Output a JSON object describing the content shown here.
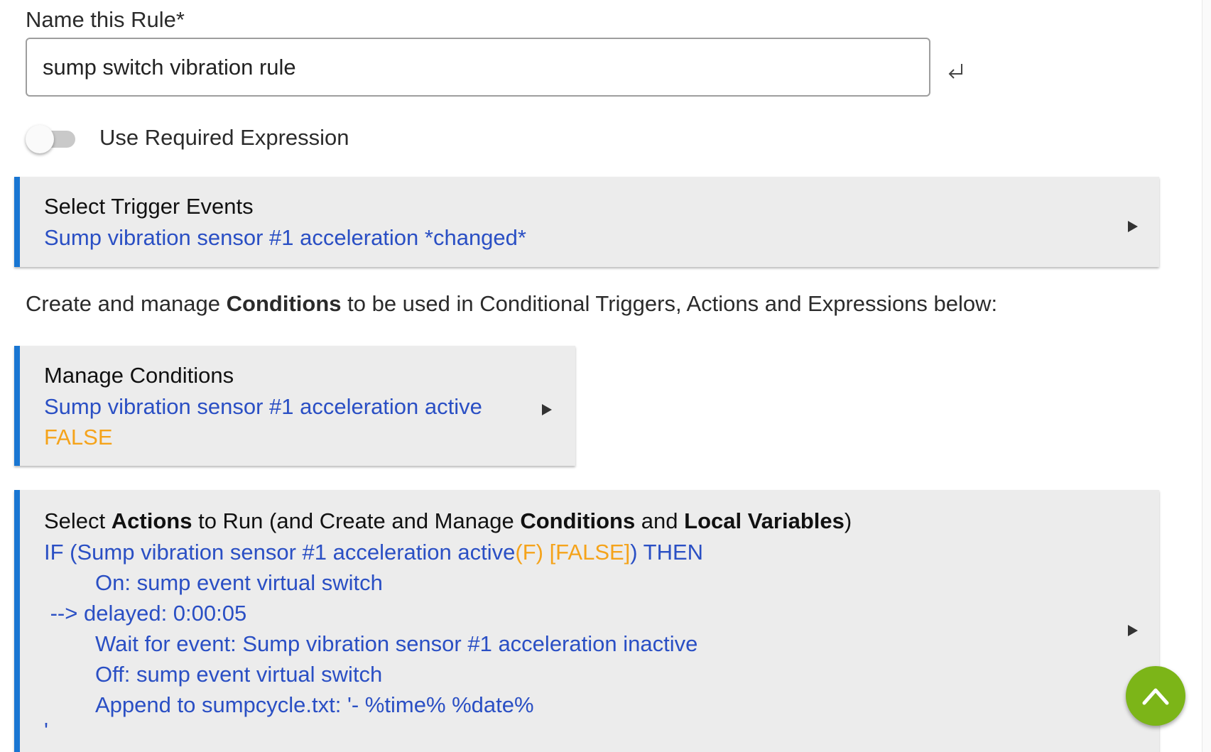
{
  "rule_name": {
    "label": "Name this Rule*",
    "value": "sump switch vibration rule"
  },
  "required_expression": {
    "label": "Use Required Expression",
    "enabled": false
  },
  "trigger_card": {
    "title": "Select Trigger Events",
    "summary": "Sump vibration sensor #1 acceleration *changed*"
  },
  "conditions_description": {
    "prefix": "Create and manage ",
    "bold": "Conditions",
    "suffix": " to be used in Conditional Triggers, Actions and Expressions below:"
  },
  "conditions_card": {
    "title": "Manage Conditions",
    "summary": "Sump vibration sensor #1 acceleration active",
    "state": "FALSE"
  },
  "actions_card": {
    "title_part1": "Select ",
    "title_bold1": "Actions",
    "title_part2": " to Run (and Create and Manage ",
    "title_bold2": "Conditions",
    "title_part3": " and ",
    "title_bold3": "Local Variables",
    "title_part4": ")",
    "if_prefix": "IF (Sump vibration sensor #1 acceleration active",
    "if_state": "(F) [FALSE]",
    "if_suffix": ") THEN",
    "lines": [
      "On: sump event virtual switch",
      " --> delayed: 0:00:05",
      "Wait for event: Sump vibration sensor #1 acceleration inactive",
      "Off: sump event virtual switch",
      "Append to sumpcycle.txt: '- %time% %date%",
      "'"
    ]
  },
  "colors": {
    "accent": "#1976d2",
    "link_blue": "#2a4fc4",
    "state_orange": "#f5a31a",
    "fab_green": "#7cb518"
  },
  "icons": {
    "enter": "enter-return-icon",
    "expand": "triangle-right-icon",
    "scroll_top": "chevron-up-icon"
  }
}
